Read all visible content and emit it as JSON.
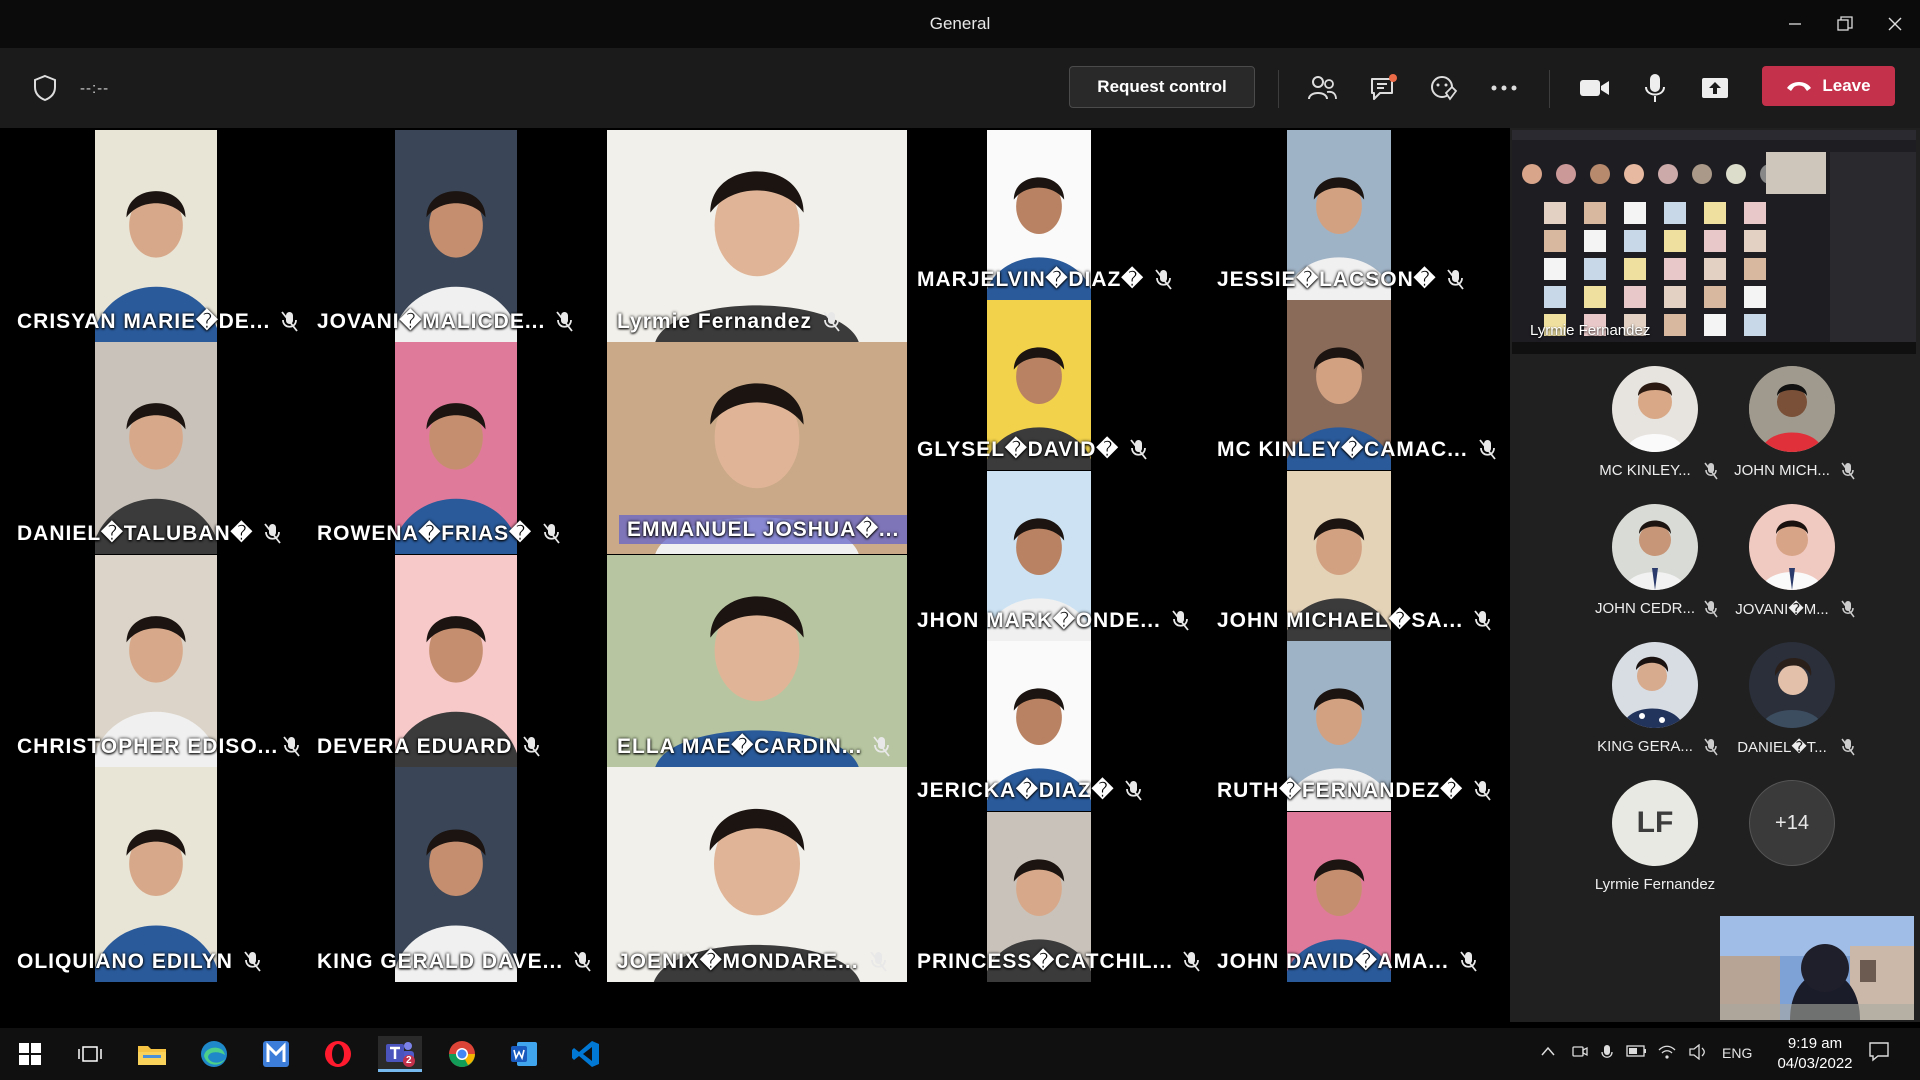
{
  "window": {
    "title": "General",
    "controls": [
      "minimize-icon",
      "restore-icon",
      "close-icon"
    ]
  },
  "toolbar": {
    "timer": "--:--",
    "request_control_label": "Request control",
    "leave_label": "Leave",
    "icons": [
      "participants-icon",
      "chat-icon",
      "reactions-icon",
      "more-options-icon",
      "camera-icon",
      "microphone-icon",
      "share-screen-icon"
    ],
    "leave_color": "#c4314b"
  },
  "participants_grid": [
    {
      "name": "CRISYAN MARIE�DE...",
      "active": false
    },
    {
      "name": "JOVANI�MALICDE...",
      "active": false
    },
    {
      "name": "Lyrmie Fernandez",
      "active": false
    },
    {
      "name": "MARJELVIN�DIAZ�",
      "active": false
    },
    {
      "name": "JESSIE�LACSON�",
      "active": false
    },
    {
      "name": "DANIEL�TALUBAN�",
      "active": false
    },
    {
      "name": "ROWENA�FRIAS�",
      "active": false
    },
    {
      "name": "EMMANUEL JOSHUA�...",
      "active": true
    },
    {
      "name": "GLYSEL�DAVID�",
      "active": false
    },
    {
      "name": "MC KINLEY�CAMAC...",
      "active": false
    },
    {
      "name": "CHRISTOPHER EDISO...",
      "active": false
    },
    {
      "name": "DEVERA EDUARD",
      "active": false
    },
    {
      "name": "ELLA MAE�CARDIN...",
      "active": false
    },
    {
      "name": "JHON MARK�ONDE...",
      "active": false
    },
    {
      "name": "JOHN MICHAEL�SA...",
      "active": false
    },
    {
      "name": "OLIQUIANO EDILYN",
      "active": false
    },
    {
      "name": "KING GERALD DAVE...",
      "active": false
    },
    {
      "name": "JOENIX�MONDARE...",
      "active": false
    },
    {
      "name": "JERICKA�DIAZ�",
      "active": false
    },
    {
      "name": "RUTH�FERNANDEZ�",
      "active": false
    },
    {
      "name": "PRINCESS�CATCHIL...",
      "active": false
    },
    {
      "name": "JOHN DAVID�AMA...",
      "active": false
    }
  ],
  "right_panel": {
    "shared_screen_presenter": "Lyrmie Fernandez",
    "people": [
      {
        "name": "MC KINLEY..."
      },
      {
        "name": "JOHN MICH..."
      },
      {
        "name": "JOHN CEDR..."
      },
      {
        "name": "JOVANI�M..."
      },
      {
        "name": "KING GERA..."
      },
      {
        "name": "DANIEL�T..."
      }
    ],
    "lf_initials": "LF",
    "lf_name": "Lyrmie Fernandez",
    "overflow_count": "+14"
  },
  "taskbar": {
    "apps": [
      "windows-start-icon",
      "task-view-icon",
      "file-explorer-icon",
      "edge-icon",
      "app-m-icon",
      "opera-icon",
      "teams-icon",
      "chrome-icon",
      "word-icon",
      "vscode-icon"
    ],
    "teams_badge": "2",
    "language": "ENG",
    "time": "9:19 am",
    "date": "04/03/2022"
  }
}
